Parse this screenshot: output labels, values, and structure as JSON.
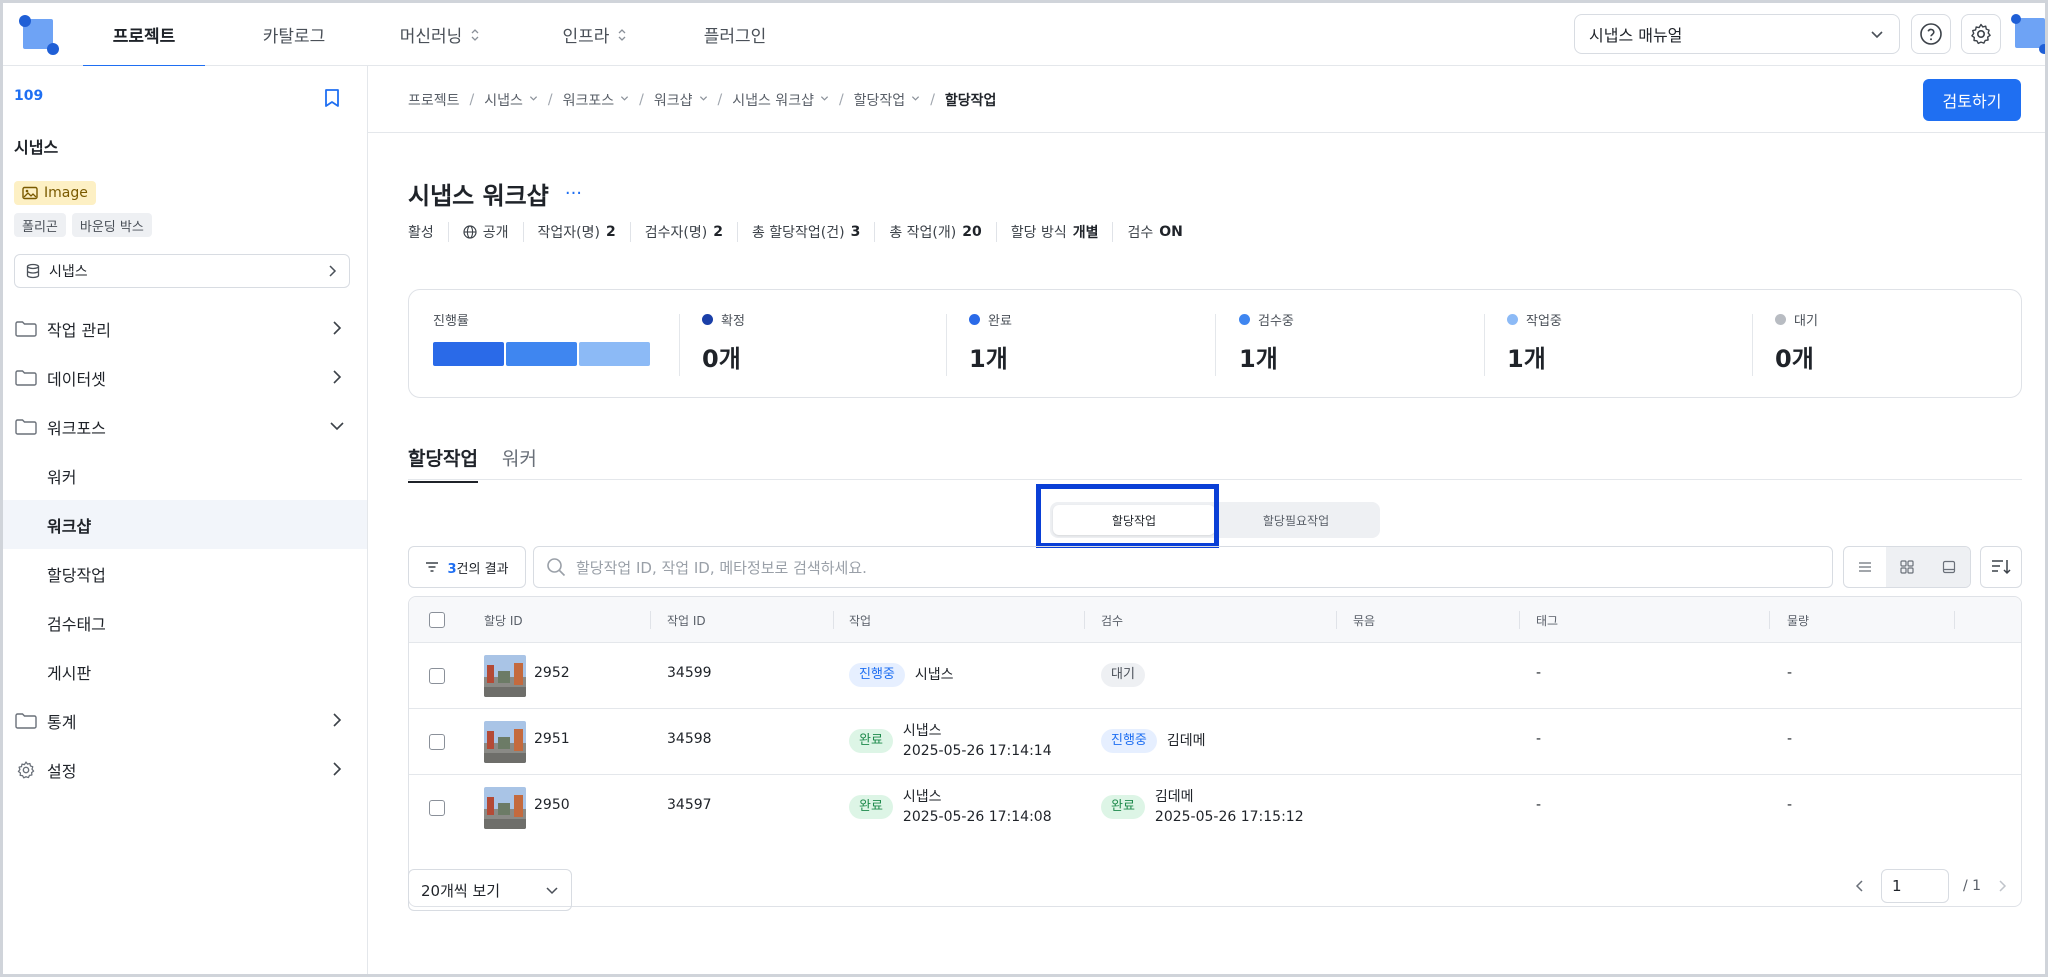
{
  "nav": {
    "items": [
      {
        "label": "프로젝트",
        "active": true,
        "dropdown": false
      },
      {
        "label": "카탈로그",
        "active": false,
        "dropdown": false
      },
      {
        "label": "머신러닝",
        "active": false,
        "dropdown": true
      },
      {
        "label": "인프라",
        "active": false,
        "dropdown": true
      },
      {
        "label": "플러그인",
        "active": false,
        "dropdown": false
      }
    ],
    "project_select": "시냅스 매뉴얼"
  },
  "sidebar": {
    "project_id": "109",
    "project_name": "시냅스",
    "type_badge": "Image",
    "tags": [
      "폴리곤",
      "바운딩 박스"
    ],
    "dataset": "시냅스",
    "menu": {
      "task_mgmt": "작업 관리",
      "dataset": "데이터셋",
      "workforce": "워크포스",
      "workforce_children": [
        "워커",
        "워크샵",
        "할당작업",
        "검수태그",
        "게시판"
      ],
      "stats": "통계",
      "settings": "설정"
    }
  },
  "breadcrumb": [
    "프로젝트",
    "시냅스",
    "워크포스",
    "워크샵",
    "시냅스 워크샵",
    "할당작업",
    "할당작업"
  ],
  "review_button": "검토하기",
  "workshop": {
    "title": "시냅스 워크샵",
    "more": "···",
    "meta": {
      "status": "활성",
      "visibility": "공개",
      "workers_label": "작업자(명)",
      "workers": "2",
      "reviewers_label": "검수자(명)",
      "reviewers": "2",
      "total_assign_label": "총 할당작업(건)",
      "total_assign": "3",
      "total_tasks_label": "총 작업(개)",
      "total_tasks": "20",
      "assign_mode_label": "할당 방식",
      "assign_mode": "개별",
      "review_label": "검수",
      "review": "ON"
    }
  },
  "stats": {
    "progress_label": "진행률",
    "items": [
      {
        "label": "확정",
        "value": "0개",
        "color": "#1a3fa8"
      },
      {
        "label": "완료",
        "value": "1개",
        "color": "#2a6ae8"
      },
      {
        "label": "검수중",
        "value": "1개",
        "color": "#3f86f0"
      },
      {
        "label": "작업중",
        "value": "1개",
        "color": "#8cbaf6"
      },
      {
        "label": "대기",
        "value": "0개",
        "color": "#b8bcc2"
      }
    ],
    "bar_colors": [
      "#2a6ae8",
      "#3f86f0",
      "#8cbaf6"
    ]
  },
  "tabs": [
    "할당작업",
    "워커"
  ],
  "segment": [
    "할당작업",
    "할당필요작업"
  ],
  "filter": {
    "count": "3",
    "suffix": "건의 결과"
  },
  "search": {
    "placeholder": "할당작업 ID, 작업 ID, 메타정보로 검색하세요."
  },
  "table": {
    "headers": [
      "할당 ID",
      "작업 ID",
      "작업",
      "검수",
      "묶음",
      "태그",
      "물량"
    ],
    "rows": [
      {
        "assign_id": "2952",
        "task_id": "34599",
        "task_status": "진행중",
        "task_status_kind": "prog",
        "task_name": "시냅스",
        "task_time": "",
        "review_status": "대기",
        "review_kind": "wait",
        "review_name": "",
        "review_time": "",
        "tag": "-",
        "qty": "-"
      },
      {
        "assign_id": "2951",
        "task_id": "34598",
        "task_status": "완료",
        "task_status_kind": "done",
        "task_name": "시냅스",
        "task_time": "2025-05-26 17:14:14",
        "review_status": "진행중",
        "review_kind": "prog",
        "review_name": "김데메",
        "review_time": "",
        "tag": "-",
        "qty": "-"
      },
      {
        "assign_id": "2950",
        "task_id": "34597",
        "task_status": "완료",
        "task_status_kind": "done",
        "task_name": "시냅스",
        "task_time": "2025-05-26 17:14:08",
        "review_status": "완료",
        "review_kind": "done",
        "review_name": "김데메",
        "review_time": "2025-05-26 17:15:12",
        "tag": "-",
        "qty": "-"
      }
    ]
  },
  "pagination": {
    "per_page": "20개씩 보기",
    "page": "1",
    "total": "/ 1"
  }
}
